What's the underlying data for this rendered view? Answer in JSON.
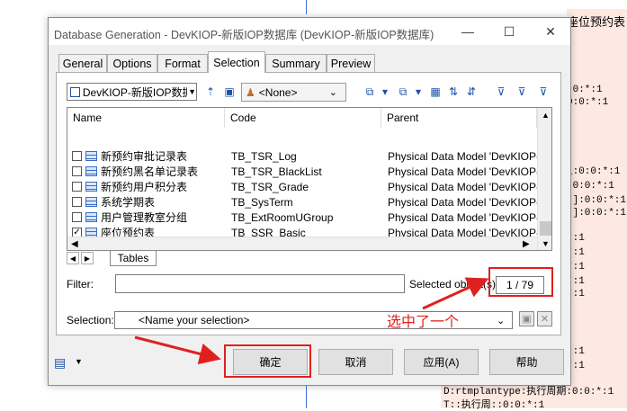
{
  "background": {
    "right_title": "座位预约表",
    "right_lines": [
      ":0:*:1",
      "0:0:*:1",
      "_:0:0:*:1",
      ":0:0:*:1",
      "[]:0:0:*:1",
      "[]:0:0:*:1",
      "*:1",
      "*:1",
      "*:1",
      "*:1",
      "*:1",
      "*:1",
      "*:1"
    ],
    "bottom_lines": [
      "D:rtmplantype:执行周期:0:0:*:1",
      "T::执行周::0:0:*:1"
    ]
  },
  "dialog": {
    "title": "Database Generation - DevKIOP-新版IOP数据库 (DevKIOP-新版IOP数据库)",
    "window_buttons": {
      "minimize": "—",
      "maximize": "☐",
      "close": "✕"
    },
    "tabs": [
      {
        "label": "General",
        "active": false
      },
      {
        "label": "Options",
        "active": false
      },
      {
        "label": "Format",
        "active": false
      },
      {
        "label": "Selection",
        "active": true
      },
      {
        "label": "Summary",
        "active": false
      },
      {
        "label": "Preview",
        "active": false
      }
    ],
    "toolbar": {
      "model_selector": "DevKIOP-新版IOP数据",
      "owner_selector": "<None>"
    },
    "list": {
      "columns": [
        "Name",
        "Code",
        "Parent"
      ],
      "rows": [
        {
          "name": "新预约审批记录表",
          "code": "TB_TSR_Log",
          "parent": "Physical Data Model 'DevKIOP-...",
          "checked": false
        },
        {
          "name": "新预约黑名单记录表",
          "code": "TB_TSR_BlackList",
          "parent": "Physical Data Model 'DevKIOP-...",
          "checked": false
        },
        {
          "name": "新预约用户积分表",
          "code": "TB_TSR_Grade",
          "parent": "Physical Data Model 'DevKIOP-...",
          "checked": false
        },
        {
          "name": "系统学期表",
          "code": "TB_SysTerm",
          "parent": "Physical Data Model 'DevKIOP-...",
          "checked": false
        },
        {
          "name": "用户管理教室分组",
          "code": "TB_ExtRoomUGroup",
          "parent": "Physical Data Model 'DevKIOP-...",
          "checked": false
        },
        {
          "name": "座位预约表",
          "code": "TB_SSR_Basic",
          "parent": "Physical Data Model 'DevKIOP-...",
          "checked": true
        }
      ],
      "sheet_tab": "Tables"
    },
    "filter": {
      "label": "Filter:",
      "value": ""
    },
    "selected_objects": {
      "label": "Selected object(s):",
      "value": "1 / 79"
    },
    "selection": {
      "label": "Selection:",
      "value": "<Name your selection>"
    },
    "buttons": {
      "ok": "确定",
      "cancel": "取消",
      "apply": "应用(A)",
      "help": "帮助"
    }
  },
  "annotation": {
    "text": "选中了一个",
    "color": "#e02020"
  }
}
